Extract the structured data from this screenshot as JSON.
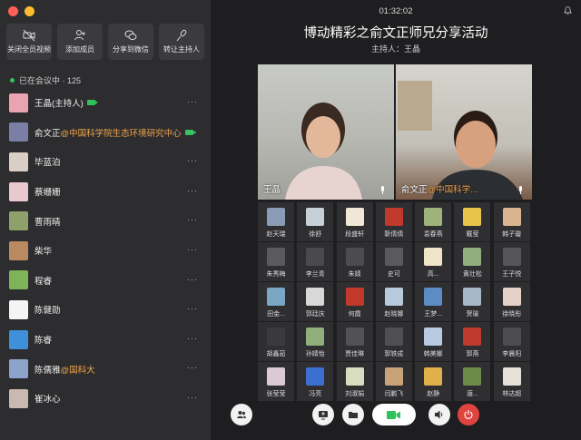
{
  "window": {
    "timer": "01:32:02"
  },
  "meeting": {
    "title": "博动精彩之俞文正师兄分享活动",
    "host": "主持人：王晶"
  },
  "actions": [
    {
      "label": "关闭全员视频",
      "icon": "video-off-icon"
    },
    {
      "label": "添加成员",
      "icon": "add-member-icon"
    },
    {
      "label": "分享到微信",
      "icon": "wechat-icon"
    },
    {
      "label": "转让主持人",
      "icon": "mic-transfer-icon"
    }
  ],
  "online": {
    "label": "已在会议中 · 125"
  },
  "members": [
    {
      "name": "王晶(主持人)",
      "org": "",
      "camera": true,
      "avatar": "#e9a3b1"
    },
    {
      "name": "俞文正",
      "org": "@中国科学院生态环境研究中心",
      "camera": true,
      "avatar": "#7b7fa6"
    },
    {
      "name": "毕蓝泊",
      "org": "",
      "camera": false,
      "avatar": "#d9cfc6"
    },
    {
      "name": "蔡姗姗",
      "org": "",
      "camera": false,
      "avatar": "#e7c9cf"
    },
    {
      "name": "曹雨晴",
      "org": "",
      "camera": false,
      "avatar": "#8fa06a"
    },
    {
      "name": "柴华",
      "org": "",
      "camera": false,
      "avatar": "#b98a5f"
    },
    {
      "name": "程睿",
      "org": "",
      "camera": false,
      "avatar": "#7fb35a"
    },
    {
      "name": "陈健勋",
      "org": "",
      "camera": false,
      "avatar": "#f4f4f4"
    },
    {
      "name": "陈睿",
      "org": "",
      "camera": false,
      "avatar": "#3f8fd9"
    },
    {
      "name": "陈儒雅",
      "org": "@国科大",
      "camera": false,
      "avatar": "#8ea3c9"
    },
    {
      "name": "崔冰心",
      "org": "",
      "camera": false,
      "avatar": "#c9b9b0"
    }
  ],
  "more_label": "···",
  "videos": [
    {
      "name": "王晶",
      "org": ""
    },
    {
      "name": "俞文正",
      "org": "@中国科学..."
    }
  ],
  "tiles": [
    {
      "name": "赵天瑞",
      "avatar": "#8a9bb5"
    },
    {
      "name": "徐舒",
      "avatar": "#c7d0d8"
    },
    {
      "name": "段盛轩",
      "avatar": "#f1e7d6"
    },
    {
      "name": "靳倩倩",
      "avatar": "#c0392b"
    },
    {
      "name": "袁春燕",
      "avatar": "#9db37a"
    },
    {
      "name": "戴莹",
      "avatar": "#e8c44a"
    },
    {
      "name": "韩子璇",
      "avatar": "#d9b48f"
    },
    {
      "name": "朱秀梅",
      "avatar": "#5b5b5f"
    },
    {
      "name": "李兰青",
      "avatar": "#4a4a4e"
    },
    {
      "name": "朱婧",
      "avatar": "#4c4c50"
    },
    {
      "name": "史可",
      "avatar": "#5a5a5e"
    },
    {
      "name": "高...",
      "avatar": "#efe4c8"
    },
    {
      "name": "黄壮松",
      "avatar": "#8fb07c"
    },
    {
      "name": "王子悦",
      "avatar": "#55555a"
    },
    {
      "name": "田金...",
      "avatar": "#7aa5c4"
    },
    {
      "name": "郭廷庆",
      "avatar": "#d8d8d8"
    },
    {
      "name": "何霞",
      "avatar": "#c0392b"
    },
    {
      "name": "赵晓娜",
      "avatar": "#b7c9dd"
    },
    {
      "name": "王梦...",
      "avatar": "#5b8cc4"
    },
    {
      "name": "贺瑜",
      "avatar": "#a7b7c9"
    },
    {
      "name": "徐晓彤",
      "avatar": "#e4d2c9"
    },
    {
      "name": "胡鑫茹",
      "avatar": "#3a3a3e"
    },
    {
      "name": "孙婧怡",
      "avatar": "#8fb07c"
    },
    {
      "name": "贾佳琳",
      "avatar": "#525256"
    },
    {
      "name": "郭铁成",
      "avatar": "#505054"
    },
    {
      "name": "韩美娜",
      "avatar": "#b9cbe0"
    },
    {
      "name": "郭燕",
      "avatar": "#c0392b"
    },
    {
      "name": "李晨阳",
      "avatar": "#4d4d51"
    },
    {
      "name": "张莹莹",
      "avatar": "#dcc9d6"
    },
    {
      "name": "冯亮",
      "avatar": "#3b6fd1"
    },
    {
      "name": "刘淑娟",
      "avatar": "#d8dcc0"
    },
    {
      "name": "闫鹏飞",
      "avatar": "#c9a27a"
    },
    {
      "name": "赵静",
      "avatar": "#e2b04a"
    },
    {
      "name": "唐...",
      "avatar": "#6d8a4a"
    },
    {
      "name": "林达超",
      "avatar": "#e6e1d8"
    }
  ],
  "toolbar": [
    {
      "name": "members",
      "icon": "people-icon"
    },
    {
      "name": "share-screen",
      "icon": "screen-share-icon"
    },
    {
      "name": "files",
      "icon": "folder-icon"
    },
    {
      "name": "camera",
      "icon": "camera-icon"
    },
    {
      "name": "speaker",
      "icon": "speaker-icon"
    },
    {
      "name": "leave",
      "icon": "power-icon"
    }
  ],
  "colors": {
    "accent_green": "#2fc25b",
    "org_orange": "#f0a44b",
    "leave_red": "#e0443e"
  }
}
